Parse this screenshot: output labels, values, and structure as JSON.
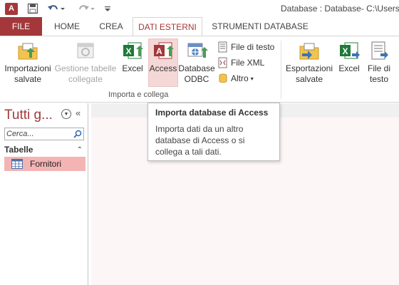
{
  "titlebar": {
    "app_icon_text": "A",
    "title": "Database : Database- C:\\Users\\"
  },
  "tabs": {
    "file": "FILE",
    "home": "HOME",
    "create": "CREA",
    "external": "DATI ESTERNI",
    "tools": "STRUMENTI DATABASE"
  },
  "ribbon": {
    "saved_imports": "Importazioni salvate",
    "linked_tables": "Gestione tabelle collegate",
    "excel": "Excel",
    "access": "Access",
    "odbc": "Database ODBC",
    "text_file": "File di testo",
    "xml_file": "File XML",
    "more": "Altro",
    "group_import": "Importa e collega",
    "saved_exports": "Esportazioni salvate",
    "export_excel": "Excel",
    "export_text": "File di testo"
  },
  "tooltip": {
    "title": "Importa database di Access",
    "body": "Importa dati da un altro database di Access o si collega a tali dati."
  },
  "nav": {
    "title": "Tutti g...",
    "search_placeholder": "Cerca...",
    "group_label": "Tabelle",
    "items": [
      {
        "label": "Fornitori"
      }
    ]
  },
  "colors": {
    "accent": "#a4373a",
    "selected_item": "#f4b4b4",
    "active_button": "#f4d7d7"
  }
}
